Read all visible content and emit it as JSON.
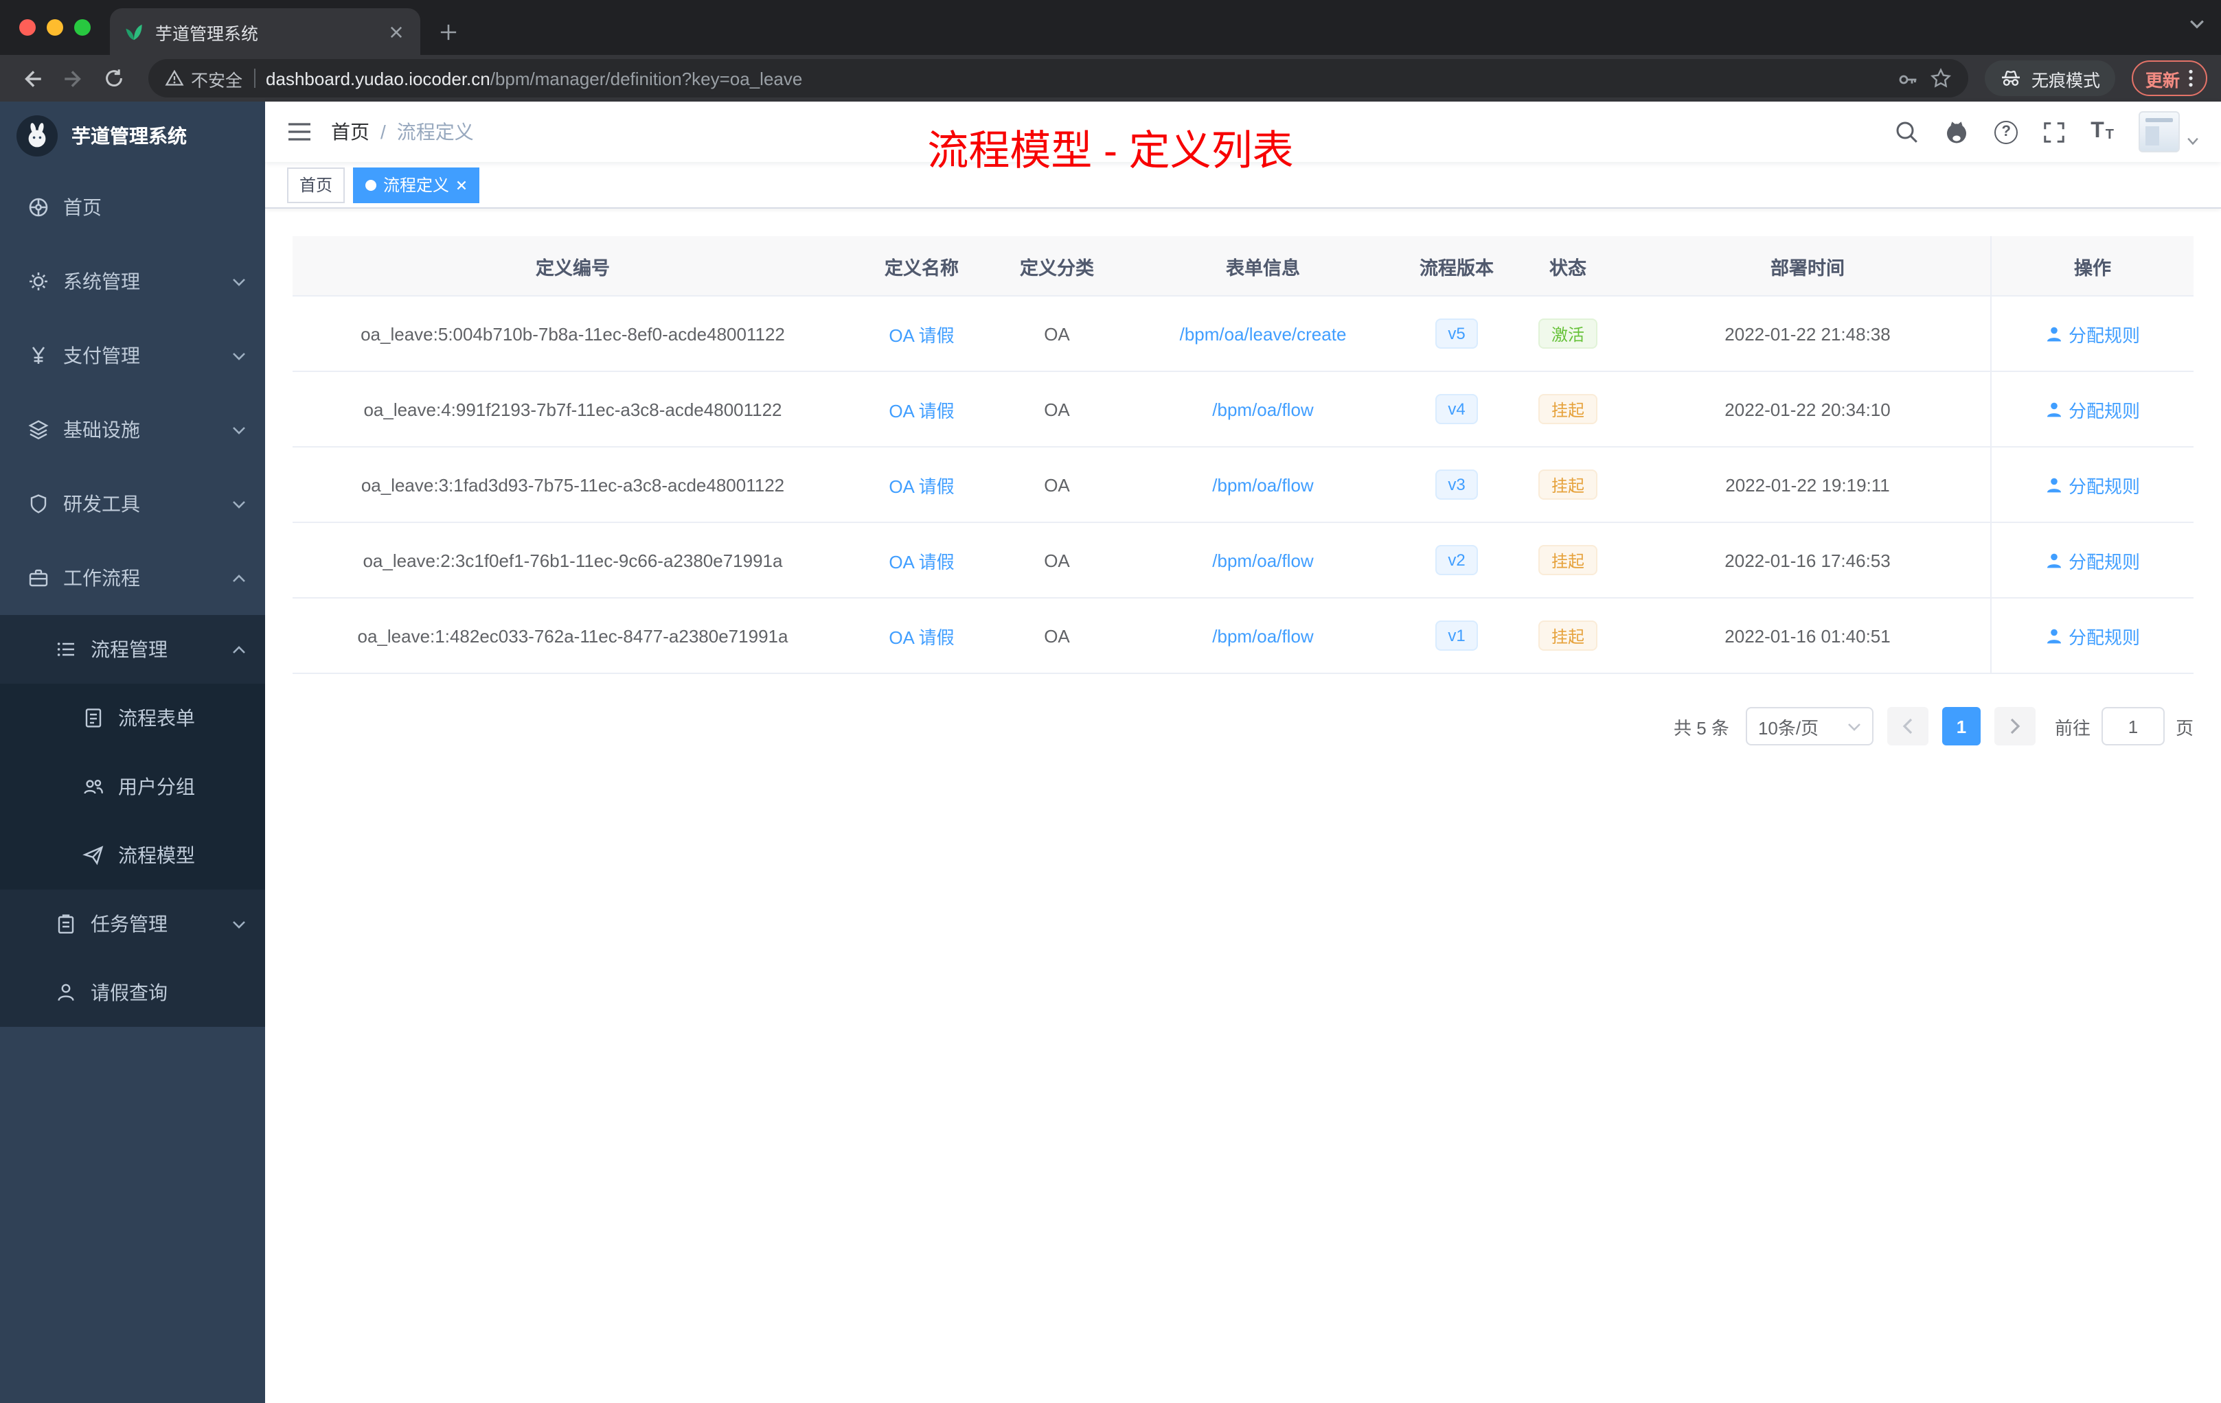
{
  "colors": {
    "primary": "#409eff",
    "success": "#67c23a",
    "warning": "#e6a23c",
    "annotation_red": "#f70000",
    "sidebar_bg": "#304156",
    "submenu_bg": "#1f2d3d",
    "submenu_deep": "#182634"
  },
  "browser": {
    "tab": {
      "title": "芋道管理系统"
    },
    "address": {
      "security": "不安全",
      "host": "dashboard.yudao.iocoder.cn",
      "path": "/bpm/manager/definition?key=oa_leave"
    },
    "incognito_label": "无痕模式",
    "update_label": "更新"
  },
  "sidebar": {
    "logo_title": "芋道管理系统",
    "menu": [
      {
        "label": "首页"
      },
      {
        "label": "系统管理"
      },
      {
        "label": "支付管理"
      },
      {
        "label": "基础设施"
      },
      {
        "label": "研发工具"
      },
      {
        "label": "工作流程"
      },
      {
        "label": "流程管理"
      },
      {
        "label": "流程表单"
      },
      {
        "label": "用户分组"
      },
      {
        "label": "流程模型"
      },
      {
        "label": "任务管理"
      },
      {
        "label": "请假查询"
      }
    ]
  },
  "header": {
    "breadcrumb_home": "首页",
    "breadcrumb_sep": "/",
    "breadcrumb_current": "流程定义",
    "annotation": "流程模型 - 定义列表"
  },
  "tags": {
    "home": "首页",
    "active": "流程定义"
  },
  "table": {
    "columns": {
      "id": "定义编号",
      "name": "定义名称",
      "category": "定义分类",
      "form": "表单信息",
      "version": "流程版本",
      "status": "状态",
      "deploy_time": "部署时间",
      "actions": "操作"
    },
    "rows": [
      {
        "id": "oa_leave:5:004b710b-7b8a-11ec-8ef0-acde48001122",
        "name": "OA 请假",
        "category": "OA",
        "form": "/bpm/oa/leave/create",
        "version": "v5",
        "status": "激活",
        "deploy_time": "2022-01-22 21:48:38",
        "action": "分配规则"
      },
      {
        "id": "oa_leave:4:991f2193-7b7f-11ec-a3c8-acde48001122",
        "name": "OA 请假",
        "category": "OA",
        "form": "/bpm/oa/flow",
        "version": "v4",
        "status": "挂起",
        "deploy_time": "2022-01-22 20:34:10",
        "action": "分配规则"
      },
      {
        "id": "oa_leave:3:1fad3d93-7b75-11ec-a3c8-acde48001122",
        "name": "OA 请假",
        "category": "OA",
        "form": "/bpm/oa/flow",
        "version": "v3",
        "status": "挂起",
        "deploy_time": "2022-01-22 19:19:11",
        "action": "分配规则"
      },
      {
        "id": "oa_leave:2:3c1f0ef1-76b1-11ec-9c66-a2380e71991a",
        "name": "OA 请假",
        "category": "OA",
        "form": "/bpm/oa/flow",
        "version": "v2",
        "status": "挂起",
        "deploy_time": "2022-01-16 17:46:53",
        "action": "分配规则"
      },
      {
        "id": "oa_leave:1:482ec033-762a-11ec-8477-a2380e71991a",
        "name": "OA 请假",
        "category": "OA",
        "form": "/bpm/oa/flow",
        "version": "v1",
        "status": "挂起",
        "deploy_time": "2022-01-16 01:40:51",
        "action": "分配规则"
      }
    ]
  },
  "pagination": {
    "total": "共 5 条",
    "page_size": "10条/页",
    "page": "1",
    "goto_label": "前往",
    "goto_value": "1",
    "unit_label": "页"
  }
}
